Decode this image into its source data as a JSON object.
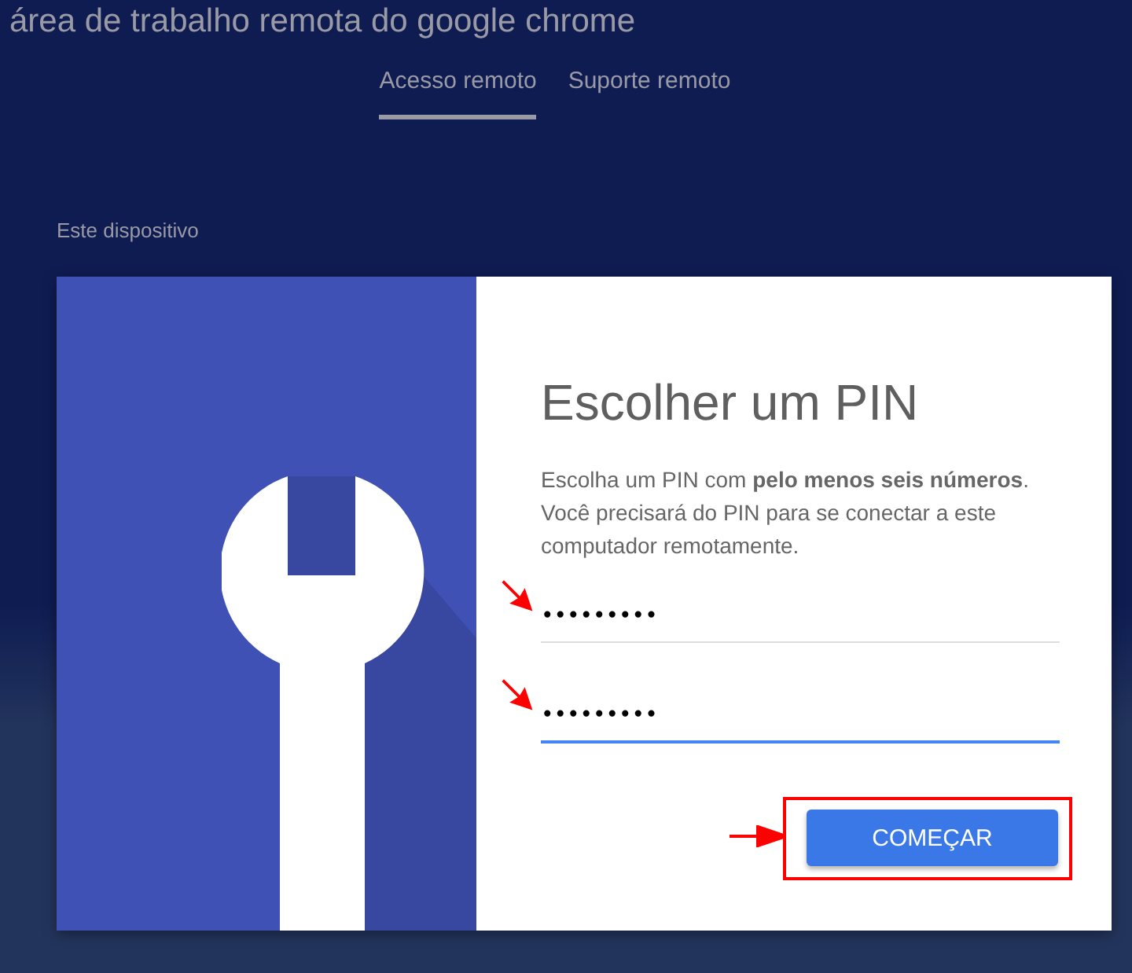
{
  "header": {
    "title": "área de trabalho remota do google chrome"
  },
  "tabs": [
    {
      "label": "Acesso remoto",
      "selected": true
    },
    {
      "label": "Suporte remoto",
      "selected": false
    }
  ],
  "section": {
    "label": "Este dispositivo"
  },
  "dialog": {
    "heading": "Escolher um PIN",
    "description": "Escolha um PIN com **pelo menos seis números**. Você precisará do PIN para se conectar a este computador remotamente.",
    "fields": [
      {
        "value": "•••••••••",
        "focused": false,
        "arrow": true
      },
      {
        "value": "•••••••••",
        "focused": true,
        "arrow": true
      }
    ],
    "button": {
      "label": "COMEÇAR",
      "highlighted": true,
      "arrow": true
    }
  }
}
